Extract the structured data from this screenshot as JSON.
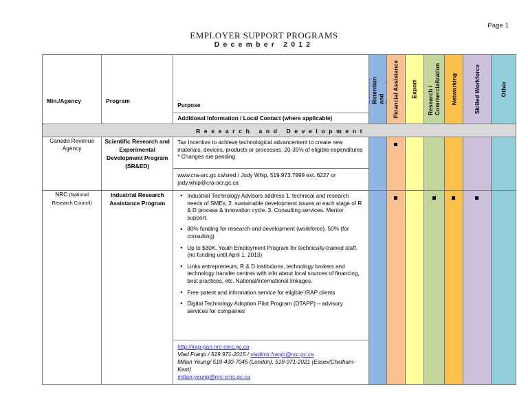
{
  "page": {
    "page_number": "Page 1",
    "title": "EMPLOYER SUPPORT PROGRAMS",
    "subtitle": "December 2012"
  },
  "table": {
    "headers": {
      "agency": "Min./Agency",
      "program": "Program",
      "purpose": "Purpose",
      "additional_info": "Additional Information / Local Contact (where applicable)"
    },
    "category_columns": [
      {
        "label": "Business Retention and Expansion",
        "color": "#8eb4e3",
        "two_line": true
      },
      {
        "label": "Financial Assistance",
        "color": "#fac090",
        "two_line": false
      },
      {
        "label": "Export",
        "color": "#ffff99",
        "two_line": false
      },
      {
        "label": "Research / Commercialization",
        "color": "#c2d69b",
        "two_line": true
      },
      {
        "label": "Networking",
        "color": "#fac04a",
        "two_line": false
      },
      {
        "label": "Skilled Workforce",
        "color": "#ccc0da",
        "two_line": false
      },
      {
        "label": "Other",
        "color": "#92cddc",
        "two_line": false
      }
    ],
    "sections": [
      {
        "label": "Research and Development",
        "rows": [
          {
            "agency": "Canada Revenue",
            "agency_line2": "Agency",
            "agency_small": "",
            "program": "Scientific Research and Experimental Development Program (SR&ED)",
            "purpose_text": "Tax Incentive to achieve technological advancement to create new materials, devices, products or processes.  20-35% of eligible expenditures * Changes are pending",
            "bullets": [],
            "contact_lines": [
              {
                "segments": [
                  {
                    "text": "www.cra-arc.gc.ca/sred   / Jody Whip, 519.973.7999 ext. 6227 or",
                    "style": "plain"
                  }
                ]
              },
              {
                "segments": [
                  {
                    "text": "jody.whip@cra-acr.gc.ca",
                    "style": "plain"
                  }
                ]
              }
            ],
            "marks": [
              false,
              true,
              false,
              false,
              false,
              false,
              false
            ]
          },
          {
            "agency": "NRC",
            "agency_small": "(National Research Council)",
            "program": "Industrial Research Assistance Program",
            "purpose_text": "",
            "bullets": [
              "Industrial Technology Advisors address 1. technical and research needs of SMEs; 2. sustainable development issues at each stage of R & D process & innovation cycle. 3. Consulting services. Mentor support.",
              "80% funding for research and development (workforce), 50% (for consulting)",
              "Up to $30K. Youth Employment Program for technically-trained staff. (no funding until April 1, 2013)",
              "Links entrepreneurs, R & D institutions, technology brokers and technology transfer centres with info about local sources of financing, best practices, etc. National/international linkages.",
              "Free patent and information service for eligible IRAP clients",
              "Digital Technology Adoption Pilot Program (DTAPP) – advisory services for companies"
            ],
            "contact_lines": [
              {
                "segments": [
                  {
                    "text": "http://irap-pari.nrc-cnrc.gc.ca",
                    "style": "link"
                  }
                ]
              },
              {
                "segments": [
                  {
                    "text": "Vlad Franjo / 519.971-2015 / ",
                    "style": "italic"
                  },
                  {
                    "text": "vladimir.franjo@nrc.gc.ca",
                    "style": "link-italic"
                  }
                ]
              },
              {
                "segments": [
                  {
                    "text": "Millan Yeung/ 519-430-7045 (London), 519-971-2021 (Essex/Chatham-Kent)",
                    "style": "italic"
                  }
                ]
              },
              {
                "segments": [
                  {
                    "text": "millan.yeung@nrc-cnrc.gc.ca",
                    "style": "link"
                  }
                ]
              }
            ],
            "marks": [
              false,
              true,
              false,
              true,
              true,
              true,
              false
            ]
          }
        ]
      }
    ]
  }
}
